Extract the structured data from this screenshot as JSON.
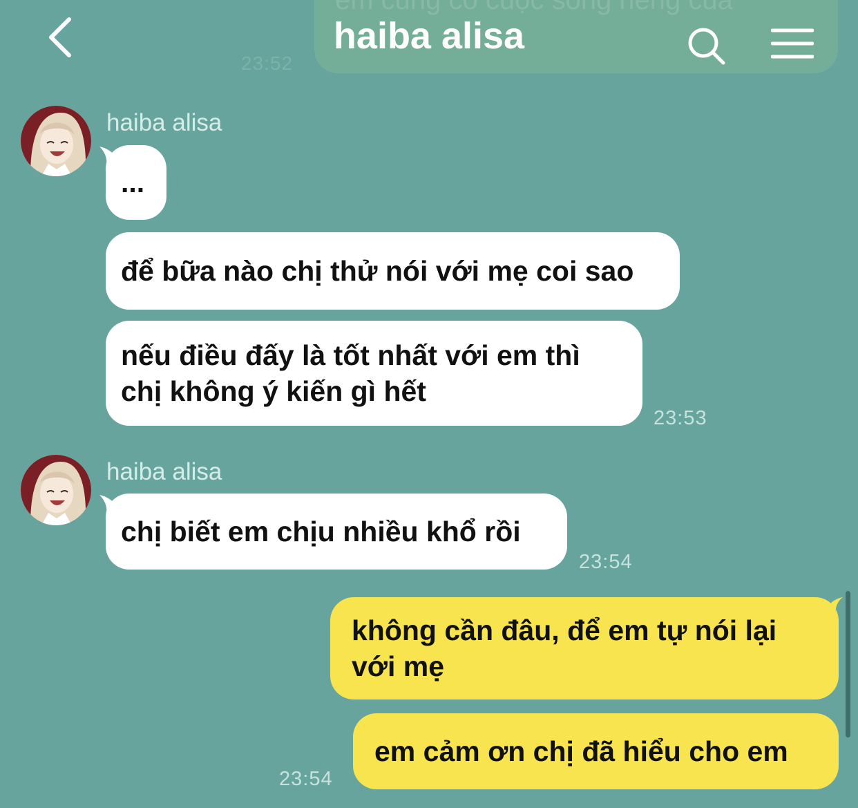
{
  "header": {
    "title": "haiba alisa",
    "back_icon": "chevron-left-icon",
    "search_icon": "search-icon",
    "menu_icon": "menu-icon",
    "color": "#ffffff"
  },
  "background_color": "#67a49e",
  "previous_message": {
    "text": "em cũng có cuộc sống riêng của",
    "time": "23:52"
  },
  "groups": [
    {
      "sender": "haiba alisa",
      "avatar_icon": "avatar-icon",
      "messages": [
        {
          "text": "..."
        },
        {
          "text": "để bữa nào chị thử nói với mẹ coi sao"
        },
        {
          "text": "nếu điều đấy là tốt nhất với em thì\nchị không ý kiến gì hết"
        }
      ],
      "time": "23:53"
    },
    {
      "sender": "haiba alisa",
      "avatar_icon": "avatar-icon",
      "messages": [
        {
          "text": "chị biết em chịu nhiều khổ rồi"
        }
      ],
      "time": "23:54"
    }
  ],
  "my_messages": [
    {
      "text": "không cần đâu, để em tự nói lại\nvới mẹ"
    },
    {
      "text": "em cảm ơn chị đã hiểu cho em"
    }
  ],
  "my_time": "23:54",
  "colors": {
    "incoming_bubble": "#ffffff",
    "outgoing_bubble": "#f7e44e",
    "timestamp": "#c7e1dc"
  }
}
